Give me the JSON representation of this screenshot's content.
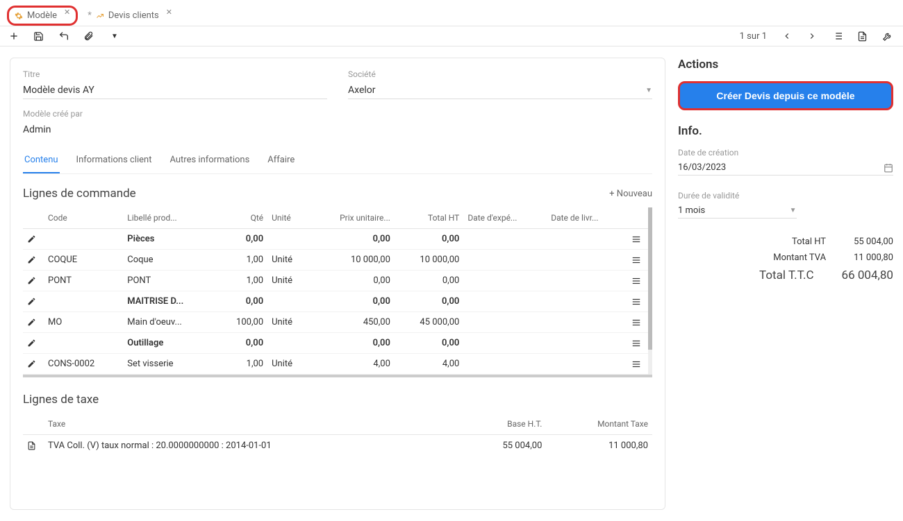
{
  "tabs": [
    {
      "label": "Modèle",
      "icon": "gear"
    },
    {
      "label": "Devis clients",
      "icon": "chart",
      "prefix": "*"
    }
  ],
  "pager": "1 sur 1",
  "form": {
    "title_label": "Titre",
    "title_value": "Modèle devis AY",
    "company_label": "Société",
    "company_value": "Axelor",
    "createdby_label": "Modèle créé par",
    "createdby_value": "Admin"
  },
  "formTabs": [
    "Contenu",
    "Informations client",
    "Autres informations",
    "Affaire"
  ],
  "orderLines": {
    "title": "Lignes de commande",
    "addNew": "Nouveau",
    "columns": [
      "Code",
      "Libellé prod...",
      "Qté",
      "Unité",
      "Prix unitaire...",
      "Total HT",
      "Date d'expé...",
      "Date de livr..."
    ],
    "rows": [
      {
        "code": "",
        "label": "Pièces",
        "bold": true,
        "qty": "0,00",
        "unit": "",
        "price": "0,00",
        "total": "0,00",
        "d1": "",
        "d2": ""
      },
      {
        "code": "COQUE",
        "label": "Coque",
        "qty": "1,00",
        "unit": "Unité",
        "price": "10 000,00",
        "total": "10 000,00",
        "d1": "",
        "d2": ""
      },
      {
        "code": "PONT",
        "label": "PONT",
        "qty": "1,00",
        "unit": "Unité",
        "price": "0,00",
        "total": "0,00",
        "d1": "",
        "d2": ""
      },
      {
        "code": "",
        "label": "MAITRISE D...",
        "bold": true,
        "qty": "0,00",
        "unit": "",
        "price": "0,00",
        "total": "0,00",
        "d1": "",
        "d2": ""
      },
      {
        "code": "MO",
        "label": "Main d'oeuv...",
        "qty": "100,00",
        "unit": "Unité",
        "price": "450,00",
        "total": "45 000,00",
        "d1": "",
        "d2": ""
      },
      {
        "code": "",
        "label": "Outillage",
        "bold": true,
        "qty": "0,00",
        "unit": "",
        "price": "0,00",
        "total": "0,00",
        "d1": "",
        "d2": ""
      },
      {
        "code": "CONS-0002",
        "label": "Set visserie",
        "qty": "1,00",
        "unit": "Unité",
        "price": "4,00",
        "total": "4,00",
        "d1": "",
        "d2": ""
      }
    ]
  },
  "taxLines": {
    "title": "Lignes de taxe",
    "columns": [
      "Taxe",
      "Base H.T.",
      "Montant Taxe"
    ],
    "rows": [
      {
        "tax": "TVA Coll. (V) taux normal : 20.0000000000 : 2014-01-01",
        "base": "55 004,00",
        "amount": "11 000,80"
      }
    ]
  },
  "actions": {
    "title": "Actions",
    "createBtn": "Créer Devis depuis ce modèle"
  },
  "info": {
    "title": "Info.",
    "createdDate_label": "Date de création",
    "createdDate_value": "16/03/2023",
    "validity_label": "Durée de validité",
    "validity_value": "1 mois"
  },
  "totals": {
    "ht_label": "Total HT",
    "ht_value": "55 004,00",
    "tva_label": "Montant TVA",
    "tva_value": "11 000,80",
    "ttc_label": "Total T.T.C",
    "ttc_value": "66 004,80"
  }
}
